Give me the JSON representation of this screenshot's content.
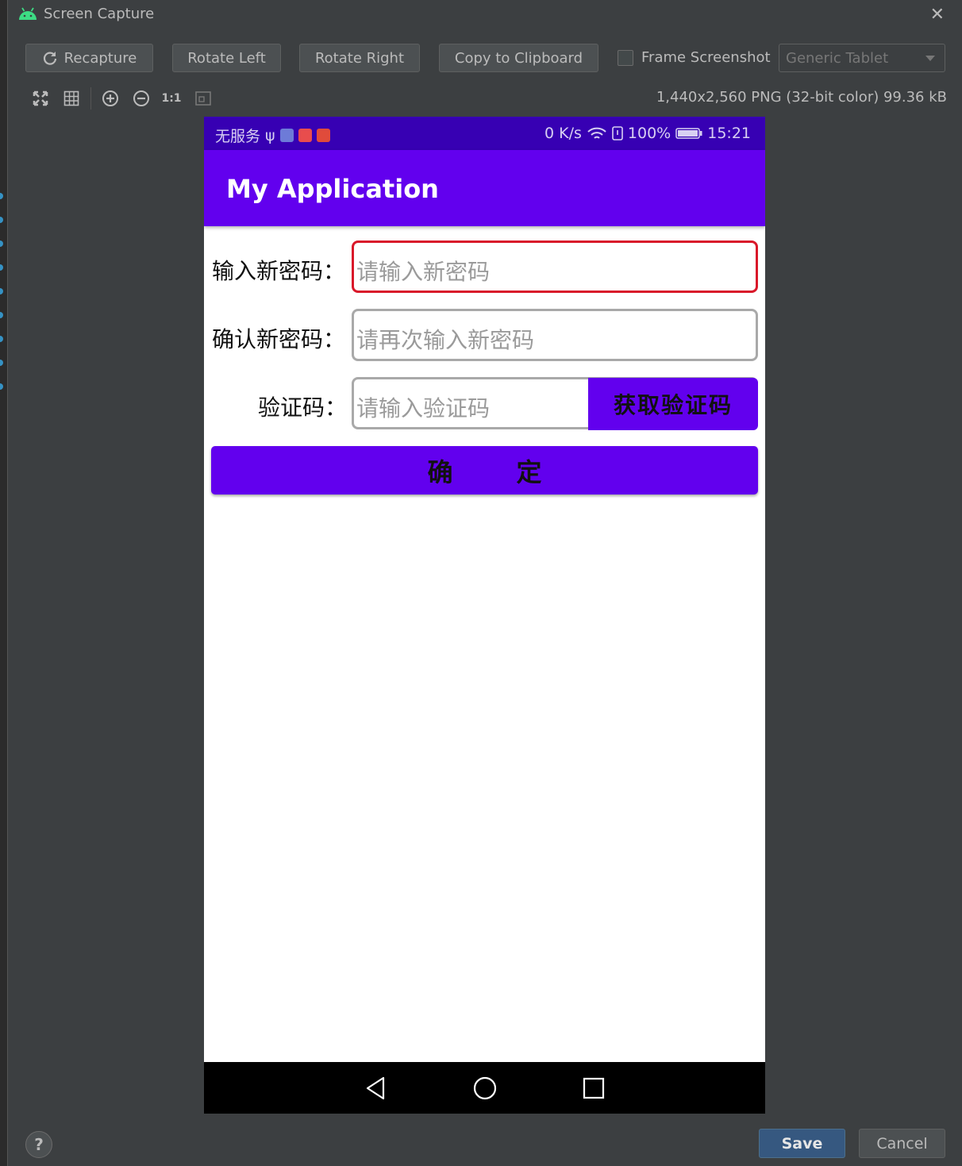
{
  "window": {
    "title": "Screen Capture",
    "close_glyph": "✕"
  },
  "toolbar": {
    "recapture": "Recapture",
    "rotate_left": "Rotate Left",
    "rotate_right": "Rotate Right",
    "copy_clipboard": "Copy to Clipboard",
    "frame_screenshot": "Frame Screenshot",
    "frame_checked": false,
    "device_select": "Generic Tablet"
  },
  "zoom_tools": {
    "one_to_one": "1:1"
  },
  "image_info": "1,440x2,560 PNG (32-bit color) 99.36 kB",
  "phone": {
    "status": {
      "carrier": "无服务",
      "usb_glyph": "ψ",
      "speed": "0 K/s",
      "battery": "100%",
      "time": "15:21"
    },
    "app_title": "My Application",
    "form": {
      "new_password_label": "输入新密码：",
      "new_password_placeholder": "请输入新密码",
      "confirm_password_label": "确认新密码：",
      "confirm_password_placeholder": "请再次输入新密码",
      "code_label": "验证码：",
      "code_placeholder": "请输入验证码",
      "get_code_button": "获取验证码",
      "confirm_button": "确定"
    }
  },
  "footer": {
    "help": "?",
    "save": "Save",
    "cancel": "Cancel"
  },
  "colors": {
    "ide_background": "#3c3f41",
    "status_bar": "#3700b3",
    "primary": "#6200ee",
    "focus_border": "#d9182a",
    "save_button": "#365880"
  }
}
